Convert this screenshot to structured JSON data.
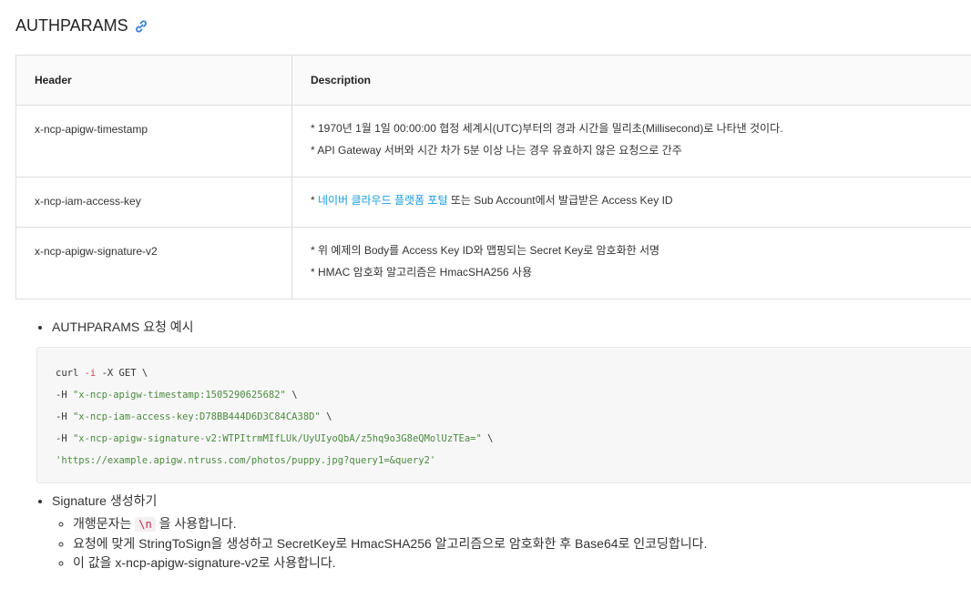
{
  "heading": {
    "title": "AUTHPARAMS"
  },
  "table": {
    "headers": [
      "Header",
      "Description"
    ],
    "rows": [
      {
        "header": "x-ncp-apigw-timestamp",
        "desc": [
          "* 1970년 1월 1일 00:00:00 협정 세계시(UTC)부터의 경과 시간을 밀리초(Millisecond)로 나타낸 것이다.",
          "* API Gateway 서버와 시간 차가 5분 이상 나는 경우 유효하지 않은 요청으로 간주"
        ]
      },
      {
        "header": "x-ncp-iam-access-key",
        "desc_prefix": "* ",
        "desc_link": "네이버 클라우드 플랫폼 포털",
        "desc_suffix": " 또는 Sub Account에서 발급받은 Access Key ID"
      },
      {
        "header": "x-ncp-apigw-signature-v2",
        "desc": [
          "* 위 예제의 Body를 Access Key ID와 맵핑되는 Secret Key로 암호화한 서명",
          "* HMAC 암호화 알고리즘은 HmacSHA256 사용"
        ]
      }
    ]
  },
  "example": {
    "title": "AUTHPARAMS 요청 예시",
    "code": {
      "l1_a": "curl ",
      "l1_flag": "-i",
      "l1_b": " -X GET \\",
      "l2_a": "-H ",
      "l2_str": "\"x-ncp-apigw-timestamp:1505290625682\"",
      "l2_b": " \\",
      "l3_a": "-H ",
      "l3_str": "\"x-ncp-iam-access-key:D78BB444D6D3C84CA38D\"",
      "l3_b": " \\",
      "l4_a": "-H ",
      "l4_str": "\"x-ncp-apigw-signature-v2:WTPItrmMIfLUk/UyUIyoQbA/z5hq9o3G8eQMolUzTEa=\"",
      "l4_b": " \\",
      "l5_str": "'https://example.apigw.ntruss.com/photos/puppy.jpg?query1=&query2'"
    }
  },
  "signature": {
    "title": "Signature 생성하기",
    "item1_a": "개행문자는 ",
    "item1_code": "\\n",
    "item1_b": " 을 사용합니다.",
    "item2": "요청에 맞게 StringToSign을 생성하고 SecretKey로 HmacSHA256 알고리즘으로 암호화한 후 Base64로 인코딩합니다.",
    "item3": "이 값을 x-ncp-apigw-signature-v2로 사용합니다."
  },
  "colors": {
    "link": "#1a9bdc",
    "string": "#4a8a3c",
    "anchor_icon": "#3b7bd0"
  },
  "icons": {
    "heading_anchor": "link-icon"
  }
}
